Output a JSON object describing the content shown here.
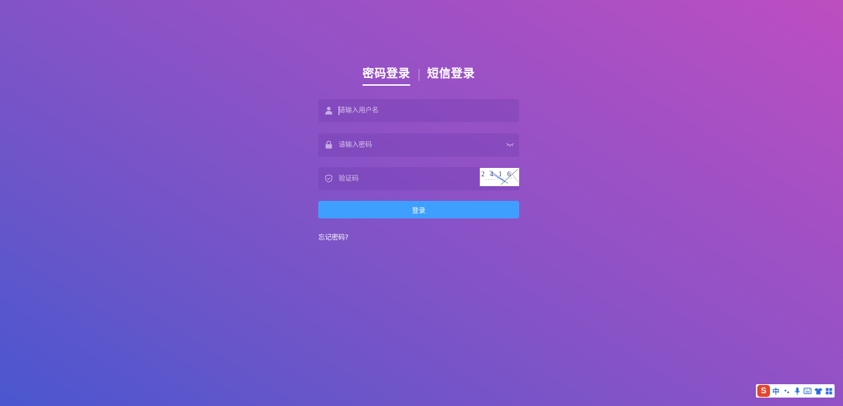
{
  "tabs": {
    "password_login": "密码登录",
    "sms_login": "短信登录"
  },
  "username": {
    "placeholder": "请输入用户名",
    "value": "",
    "icon": "user-icon"
  },
  "password": {
    "placeholder": "请输入密码",
    "value": "",
    "icon": "lock-icon",
    "toggle_icon": "eye-closed-icon"
  },
  "captcha": {
    "placeholder": "验证码",
    "value": "",
    "icon": "shield-icon",
    "image_text": "2 4 1 6"
  },
  "login_button": "登录",
  "forgot_password": "忘记密码?",
  "ime_toolbar": {
    "logo": "S",
    "mode": "中",
    "items": [
      "punctuation-icon",
      "microphone-icon",
      "keyboard-icon",
      "skin-icon",
      "toolbox-icon"
    ]
  },
  "colors": {
    "button": "#3e9fff",
    "background_start": "#4a57cf",
    "background_end": "#bd4ec0"
  }
}
